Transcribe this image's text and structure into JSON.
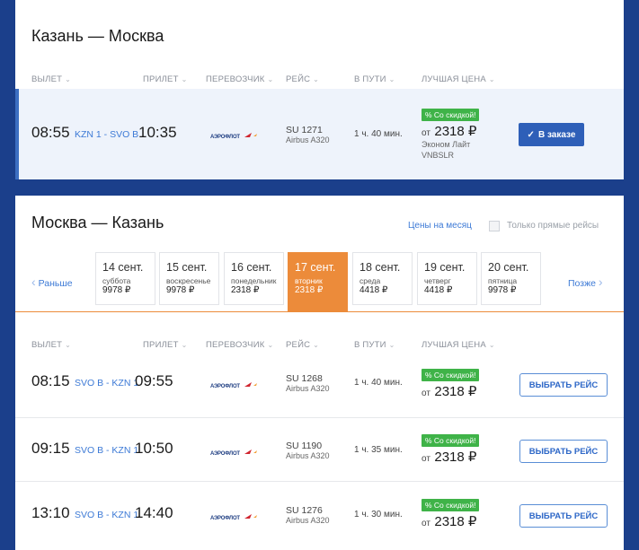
{
  "outbound": {
    "title": "Казань — Москва",
    "columns": {
      "departure": "ВЫЛЕТ",
      "arrival": "ПРИЛЕТ",
      "carrier": "ПЕРЕВОЗЧИК",
      "flight": "РЕЙС",
      "duration": "В ПУТИ",
      "best_price": "ЛУЧШАЯ ЦЕНА"
    },
    "flight": {
      "dep_time": "08:55",
      "airports": "KZN 1 - SVO B",
      "arr_time": "10:35",
      "carrier_logo": "aeroflot-logo",
      "flight_no": "SU 1271",
      "aircraft": "Airbus A320",
      "duration": "1 ч. 40 мин.",
      "discount": "% Со скидкой!",
      "price_prefix": "от",
      "price": "2318 ₽",
      "tariff": "Эконом Лайт",
      "fare_code": "VNBSLR",
      "button": "В заказе",
      "button_icon": "check-icon"
    }
  },
  "return": {
    "title": "Москва — Казань",
    "month_prices": "Цены на месяц",
    "direct_only": "Только прямые рейсы",
    "nav_prev": "Раньше",
    "nav_next": "Позже",
    "dates": [
      {
        "date": "14 сент.",
        "weekday": "суббота",
        "price": "9978 ₽"
      },
      {
        "date": "15 сент.",
        "weekday": "воскресенье",
        "price": "9978 ₽"
      },
      {
        "date": "16 сент.",
        "weekday": "понедельник",
        "price": "2318 ₽"
      },
      {
        "date": "17 сент.",
        "weekday": "вторник",
        "price": "2318 ₽"
      },
      {
        "date": "18 сент.",
        "weekday": "среда",
        "price": "4418 ₽"
      },
      {
        "date": "19 сент.",
        "weekday": "четверг",
        "price": "4418 ₽"
      },
      {
        "date": "20 сент.",
        "weekday": "пятница",
        "price": "9978 ₽"
      }
    ],
    "selected_date_index": 3,
    "columns": {
      "departure": "ВЫЛЕТ",
      "arrival": "ПРИЛЕТ",
      "carrier": "ПЕРЕВОЗЧИК",
      "flight": "РЕЙС",
      "duration": "В ПУТИ",
      "best_price": "ЛУЧШАЯ ЦЕНА"
    },
    "flights": [
      {
        "dep_time": "08:15",
        "airports": "SVO B - KZN 1",
        "arr_time": "09:55",
        "flight_no": "SU 1268",
        "aircraft": "Airbus A320",
        "duration": "1 ч. 40 мин.",
        "discount": "% Со скидкой!",
        "price_prefix": "от",
        "price": "2318 ₽",
        "button": "ВЫБРАТЬ РЕЙС"
      },
      {
        "dep_time": "09:15",
        "airports": "SVO B - KZN 1",
        "arr_time": "10:50",
        "flight_no": "SU 1190",
        "aircraft": "Airbus A320",
        "duration": "1 ч. 35 мин.",
        "discount": "% Со скидкой!",
        "price_prefix": "от",
        "price": "2318 ₽",
        "button": "ВЫБРАТЬ РЕЙС"
      },
      {
        "dep_time": "13:10",
        "airports": "SVO B - KZN 1",
        "arr_time": "14:40",
        "flight_no": "SU 1276",
        "aircraft": "Airbus A320",
        "duration": "1 ч. 30 мин.",
        "discount": "% Со скидкой!",
        "price_prefix": "от",
        "price": "2318 ₽",
        "button": "ВЫБРАТЬ РЕЙС"
      }
    ]
  },
  "colors": {
    "background": "#1b3f8b",
    "accent_blue": "#3d7ad6",
    "active_date": "#ec8b3a",
    "discount_badge": "#3fb348",
    "aeroflot_red": "#d0252f"
  }
}
